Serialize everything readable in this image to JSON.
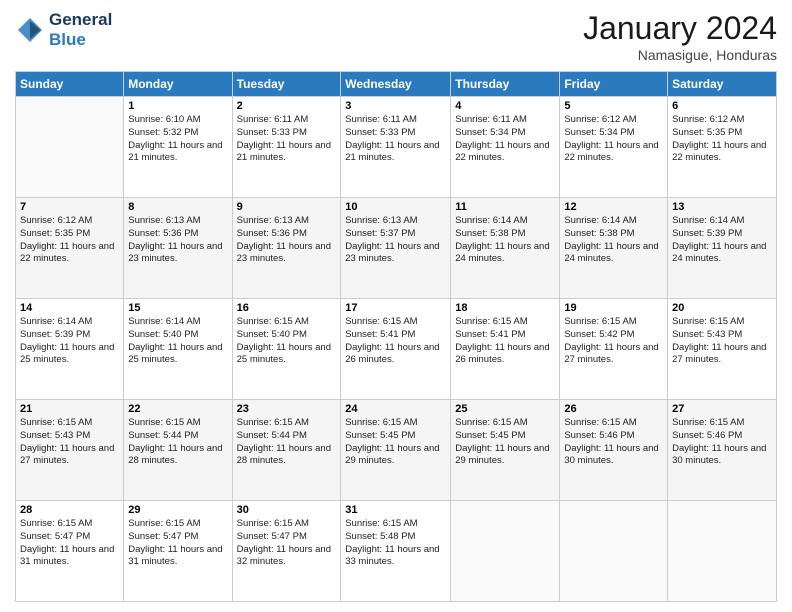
{
  "logo": {
    "line1": "General",
    "line2": "Blue"
  },
  "title": "January 2024",
  "location": "Namasigue, Honduras",
  "weekdays": [
    "Sunday",
    "Monday",
    "Tuesday",
    "Wednesday",
    "Thursday",
    "Friday",
    "Saturday"
  ],
  "weeks": [
    [
      {
        "day": "",
        "sunrise": "",
        "sunset": "",
        "daylight": ""
      },
      {
        "day": "1",
        "sunrise": "Sunrise: 6:10 AM",
        "sunset": "Sunset: 5:32 PM",
        "daylight": "Daylight: 11 hours and 21 minutes."
      },
      {
        "day": "2",
        "sunrise": "Sunrise: 6:11 AM",
        "sunset": "Sunset: 5:33 PM",
        "daylight": "Daylight: 11 hours and 21 minutes."
      },
      {
        "day": "3",
        "sunrise": "Sunrise: 6:11 AM",
        "sunset": "Sunset: 5:33 PM",
        "daylight": "Daylight: 11 hours and 21 minutes."
      },
      {
        "day": "4",
        "sunrise": "Sunrise: 6:11 AM",
        "sunset": "Sunset: 5:34 PM",
        "daylight": "Daylight: 11 hours and 22 minutes."
      },
      {
        "day": "5",
        "sunrise": "Sunrise: 6:12 AM",
        "sunset": "Sunset: 5:34 PM",
        "daylight": "Daylight: 11 hours and 22 minutes."
      },
      {
        "day": "6",
        "sunrise": "Sunrise: 6:12 AM",
        "sunset": "Sunset: 5:35 PM",
        "daylight": "Daylight: 11 hours and 22 minutes."
      }
    ],
    [
      {
        "day": "7",
        "sunrise": "Sunrise: 6:12 AM",
        "sunset": "Sunset: 5:35 PM",
        "daylight": "Daylight: 11 hours and 22 minutes."
      },
      {
        "day": "8",
        "sunrise": "Sunrise: 6:13 AM",
        "sunset": "Sunset: 5:36 PM",
        "daylight": "Daylight: 11 hours and 23 minutes."
      },
      {
        "day": "9",
        "sunrise": "Sunrise: 6:13 AM",
        "sunset": "Sunset: 5:36 PM",
        "daylight": "Daylight: 11 hours and 23 minutes."
      },
      {
        "day": "10",
        "sunrise": "Sunrise: 6:13 AM",
        "sunset": "Sunset: 5:37 PM",
        "daylight": "Daylight: 11 hours and 23 minutes."
      },
      {
        "day": "11",
        "sunrise": "Sunrise: 6:14 AM",
        "sunset": "Sunset: 5:38 PM",
        "daylight": "Daylight: 11 hours and 24 minutes."
      },
      {
        "day": "12",
        "sunrise": "Sunrise: 6:14 AM",
        "sunset": "Sunset: 5:38 PM",
        "daylight": "Daylight: 11 hours and 24 minutes."
      },
      {
        "day": "13",
        "sunrise": "Sunrise: 6:14 AM",
        "sunset": "Sunset: 5:39 PM",
        "daylight": "Daylight: 11 hours and 24 minutes."
      }
    ],
    [
      {
        "day": "14",
        "sunrise": "Sunrise: 6:14 AM",
        "sunset": "Sunset: 5:39 PM",
        "daylight": "Daylight: 11 hours and 25 minutes."
      },
      {
        "day": "15",
        "sunrise": "Sunrise: 6:14 AM",
        "sunset": "Sunset: 5:40 PM",
        "daylight": "Daylight: 11 hours and 25 minutes."
      },
      {
        "day": "16",
        "sunrise": "Sunrise: 6:15 AM",
        "sunset": "Sunset: 5:40 PM",
        "daylight": "Daylight: 11 hours and 25 minutes."
      },
      {
        "day": "17",
        "sunrise": "Sunrise: 6:15 AM",
        "sunset": "Sunset: 5:41 PM",
        "daylight": "Daylight: 11 hours and 26 minutes."
      },
      {
        "day": "18",
        "sunrise": "Sunrise: 6:15 AM",
        "sunset": "Sunset: 5:41 PM",
        "daylight": "Daylight: 11 hours and 26 minutes."
      },
      {
        "day": "19",
        "sunrise": "Sunrise: 6:15 AM",
        "sunset": "Sunset: 5:42 PM",
        "daylight": "Daylight: 11 hours and 27 minutes."
      },
      {
        "day": "20",
        "sunrise": "Sunrise: 6:15 AM",
        "sunset": "Sunset: 5:43 PM",
        "daylight": "Daylight: 11 hours and 27 minutes."
      }
    ],
    [
      {
        "day": "21",
        "sunrise": "Sunrise: 6:15 AM",
        "sunset": "Sunset: 5:43 PM",
        "daylight": "Daylight: 11 hours and 27 minutes."
      },
      {
        "day": "22",
        "sunrise": "Sunrise: 6:15 AM",
        "sunset": "Sunset: 5:44 PM",
        "daylight": "Daylight: 11 hours and 28 minutes."
      },
      {
        "day": "23",
        "sunrise": "Sunrise: 6:15 AM",
        "sunset": "Sunset: 5:44 PM",
        "daylight": "Daylight: 11 hours and 28 minutes."
      },
      {
        "day": "24",
        "sunrise": "Sunrise: 6:15 AM",
        "sunset": "Sunset: 5:45 PM",
        "daylight": "Daylight: 11 hours and 29 minutes."
      },
      {
        "day": "25",
        "sunrise": "Sunrise: 6:15 AM",
        "sunset": "Sunset: 5:45 PM",
        "daylight": "Daylight: 11 hours and 29 minutes."
      },
      {
        "day": "26",
        "sunrise": "Sunrise: 6:15 AM",
        "sunset": "Sunset: 5:46 PM",
        "daylight": "Daylight: 11 hours and 30 minutes."
      },
      {
        "day": "27",
        "sunrise": "Sunrise: 6:15 AM",
        "sunset": "Sunset: 5:46 PM",
        "daylight": "Daylight: 11 hours and 30 minutes."
      }
    ],
    [
      {
        "day": "28",
        "sunrise": "Sunrise: 6:15 AM",
        "sunset": "Sunset: 5:47 PM",
        "daylight": "Daylight: 11 hours and 31 minutes."
      },
      {
        "day": "29",
        "sunrise": "Sunrise: 6:15 AM",
        "sunset": "Sunset: 5:47 PM",
        "daylight": "Daylight: 11 hours and 31 minutes."
      },
      {
        "day": "30",
        "sunrise": "Sunrise: 6:15 AM",
        "sunset": "Sunset: 5:47 PM",
        "daylight": "Daylight: 11 hours and 32 minutes."
      },
      {
        "day": "31",
        "sunrise": "Sunrise: 6:15 AM",
        "sunset": "Sunset: 5:48 PM",
        "daylight": "Daylight: 11 hours and 33 minutes."
      },
      {
        "day": "",
        "sunrise": "",
        "sunset": "",
        "daylight": ""
      },
      {
        "day": "",
        "sunrise": "",
        "sunset": "",
        "daylight": ""
      },
      {
        "day": "",
        "sunrise": "",
        "sunset": "",
        "daylight": ""
      }
    ]
  ]
}
